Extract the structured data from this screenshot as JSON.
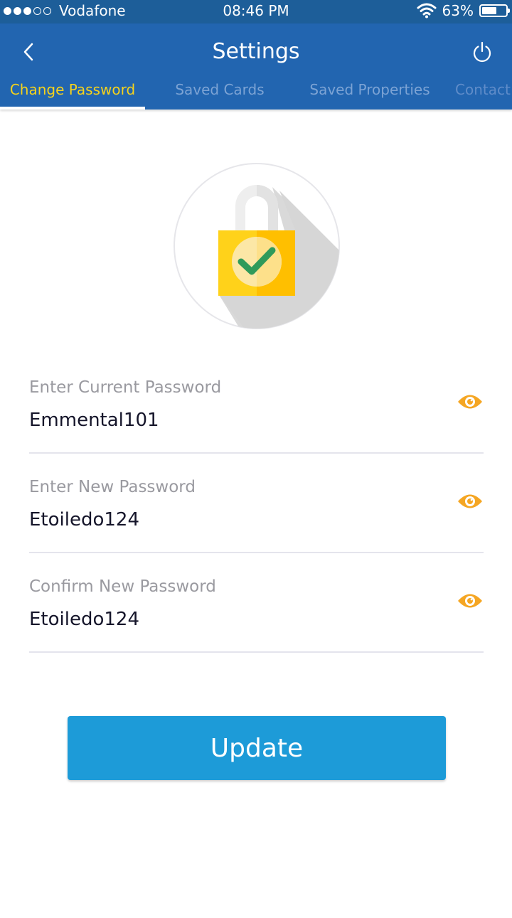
{
  "status_bar": {
    "carrier": "Vodafone",
    "signal_bars_filled": 3,
    "signal_bars_total": 5,
    "time": "08:46 PM",
    "battery_percent": "63%",
    "battery_level": 0.63
  },
  "header": {
    "title": "Settings",
    "back_icon": "chevron-left-icon",
    "power_icon": "power-icon",
    "tabs": [
      {
        "label": "Change Password",
        "active": true
      },
      {
        "label": "Saved Cards",
        "active": false
      },
      {
        "label": "Saved Properties",
        "active": false
      },
      {
        "label": "Contact",
        "active": false
      }
    ]
  },
  "illustration": {
    "icon": "padlock-check-icon"
  },
  "form": {
    "fields": [
      {
        "label": "Enter Current Password",
        "value": "Emmental101",
        "icon": "eye-icon"
      },
      {
        "label": "Enter New Password",
        "value": "Etoiledo124",
        "icon": "eye-icon"
      },
      {
        "label": "Confirm New Password",
        "value": "Etoiledo124",
        "icon": "eye-icon"
      }
    ],
    "submit_label": "Update"
  },
  "colors": {
    "header_bg": "#2265b0",
    "status_bg": "#1d5e99",
    "active_tab": "#f6d31b",
    "button_bg": "#1d9bd8",
    "eye_icon": "#f5a623"
  }
}
